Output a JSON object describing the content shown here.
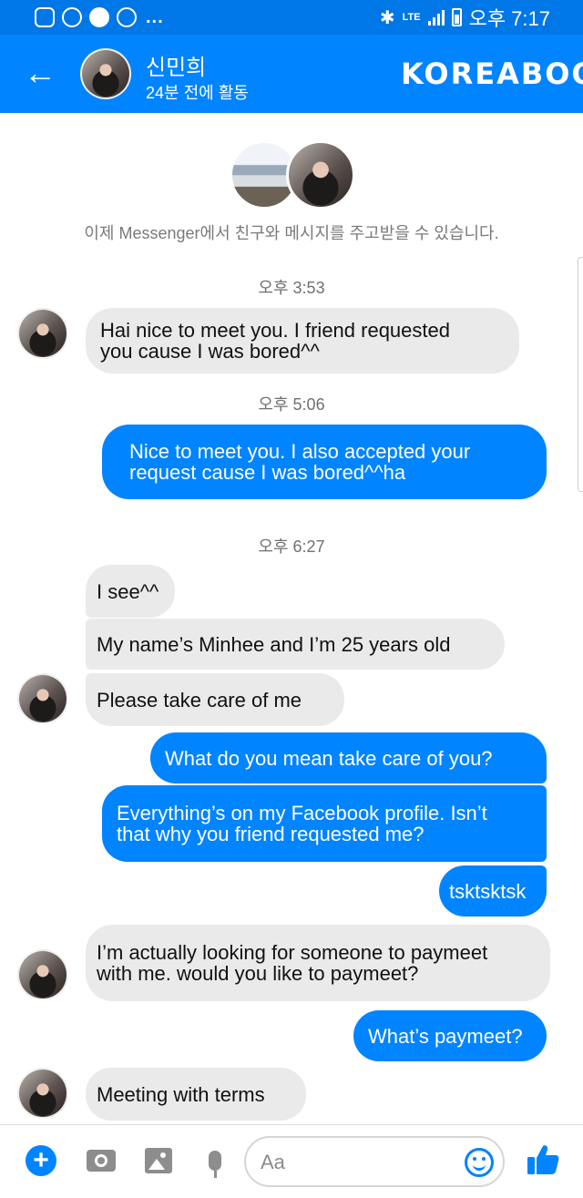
{
  "status_bar": {
    "time": "오후 7:17",
    "network": "LTE",
    "left_icons": [
      "u-app-icon",
      "instagram-icon",
      "kakaotalk-icon",
      "notification-icon"
    ],
    "overflow": "..."
  },
  "header": {
    "contact_name": "신민희",
    "active_status": "24분 전에 활동",
    "watermark": "KOREABOO"
  },
  "intro": {
    "text": "이제 Messenger에서 친구와 메시지를 주고받을 수 있습니다."
  },
  "chat": {
    "timestamps": [
      "오후 3:53",
      "오후 5:06",
      "오후 6:27"
    ],
    "messages": [
      {
        "sender": "them",
        "lines": [
          "Hai nice to meet you. I friend requested",
          "you cause I was bored^^"
        ]
      },
      {
        "sender": "me",
        "lines": [
          "Nice to meet you. I also accepted your",
          "request cause I was bored^^ha"
        ]
      },
      {
        "sender": "them",
        "lines": [
          "I see^^"
        ]
      },
      {
        "sender": "them",
        "lines": [
          "My name’s Minhee and I’m 25 years old"
        ]
      },
      {
        "sender": "them",
        "lines": [
          "Please take care of me"
        ]
      },
      {
        "sender": "me",
        "lines": [
          "What do you mean take care of you?"
        ]
      },
      {
        "sender": "me",
        "lines": [
          "Everything’s on my Facebook profile. Isn’t",
          "that why you friend requested me?"
        ]
      },
      {
        "sender": "me",
        "lines": [
          "tsktsktsk"
        ]
      },
      {
        "sender": "them",
        "lines": [
          "I’m actually looking for someone to paymeet",
          "with me. would you like to paymeet?"
        ]
      },
      {
        "sender": "me",
        "lines": [
          "What’s paymeet?"
        ]
      },
      {
        "sender": "them",
        "lines": [
          "Meeting with terms"
        ]
      }
    ]
  },
  "composer": {
    "placeholder": "Aa",
    "icons": [
      "plus-icon",
      "camera-icon",
      "image-icon",
      "microphone-icon",
      "emoji-icon",
      "thumbs-up-icon"
    ]
  },
  "colors": {
    "brand_blue": "#0084ff",
    "status_bar_blue": "#0077e6",
    "incoming_bubble": "#eaeaea",
    "outgoing_bubble": "#0084ff"
  }
}
